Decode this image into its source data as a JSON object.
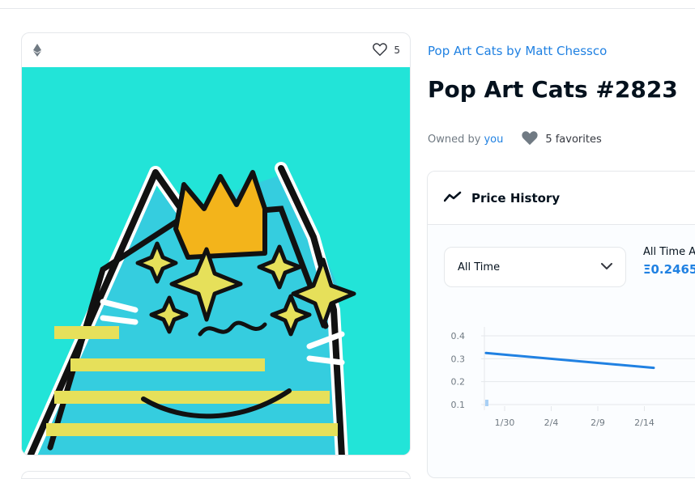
{
  "asset_card": {
    "favorites_count": "5",
    "chain_icon": "ethereum-icon",
    "favorite_icon": "heart-outline-icon",
    "image_description_colors": {
      "background": "#22e4d8",
      "crown": "#f3b41b",
      "stripes": "#e6e05a"
    }
  },
  "collection": {
    "name": "Pop Art Cats by Matt Chessco"
  },
  "asset": {
    "title": "Pop Art Cats #2823"
  },
  "ownership": {
    "owned_by_label": "Owned by",
    "owner": "you",
    "favorites_label": "5 favorites",
    "heart_icon": "heart-filled-icon"
  },
  "price_history": {
    "header_label": "Price History",
    "header_icon": "trending-line-icon",
    "period_select": {
      "selected": "All Time"
    },
    "avg_label": "All Time Av",
    "avg_value": "Ξ0.2465"
  },
  "colors": {
    "accent": "#2081e2",
    "text": "#04111d",
    "muted": "#707a83",
    "border": "#e5e8eb"
  },
  "chart_data": {
    "type": "line",
    "x_ticks": [
      "1/30",
      "2/4",
      "2/9",
      "2/14"
    ],
    "y_ticks": [
      "0.4",
      "0.3",
      "0.2",
      "0.1"
    ],
    "ylim": [
      0.1,
      0.4
    ],
    "series": [
      {
        "x": [
          "1/28",
          "2/15"
        ],
        "values": [
          0.325,
          0.26
        ]
      }
    ],
    "volume_bars": [
      {
        "x": "1/28",
        "value": 0.03
      }
    ],
    "grid": true
  }
}
